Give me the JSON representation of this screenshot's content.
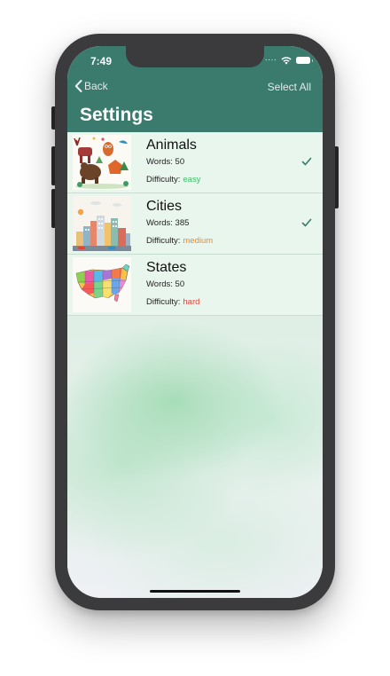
{
  "status_bar": {
    "time": "7:49"
  },
  "nav": {
    "back_label": "Back",
    "select_all_label": "Select All",
    "title": "Settings"
  },
  "colors": {
    "header": "#3a7b6e",
    "easy": "#3fbf6b",
    "medium": "#e9893a",
    "hard": "#e0463b",
    "check": "#3a7b6e"
  },
  "rows": [
    {
      "title": "Animals",
      "words": "Words: 50",
      "difficulty_label": "Difficulty:",
      "difficulty": "easy",
      "checked": true,
      "thumb_icon": "animals-illustration"
    },
    {
      "title": "Cities",
      "words": "Words: 385",
      "difficulty_label": "Difficulty:",
      "difficulty": "medium",
      "checked": true,
      "thumb_icon": "city-skyline-illustration"
    },
    {
      "title": "States",
      "words": "Words: 50",
      "difficulty_label": "Difficulty:",
      "difficulty": "hard",
      "checked": false,
      "thumb_icon": "us-map-illustration"
    }
  ]
}
